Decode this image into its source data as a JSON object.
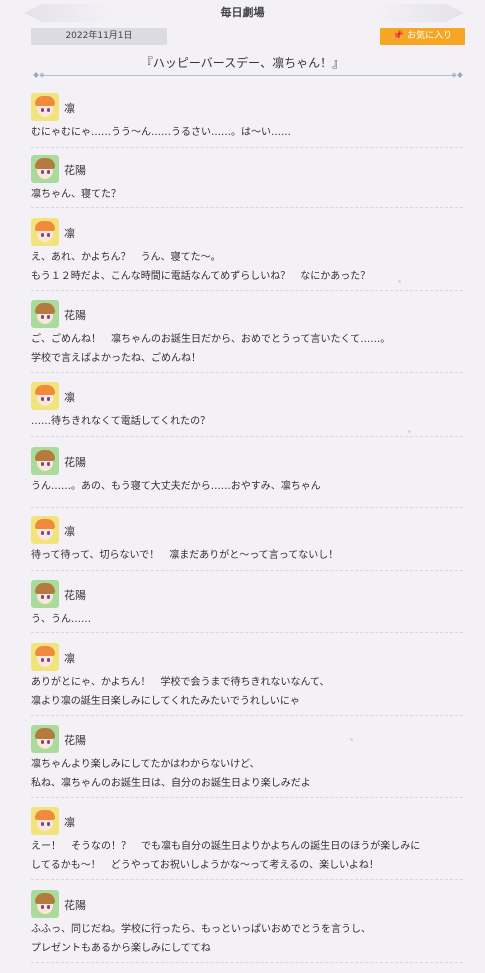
{
  "header": {
    "title": "毎日劇場"
  },
  "date": "2022年11月1日",
  "favorite_button": {
    "label": "お気に入り",
    "icon": "pin-icon"
  },
  "episode_title": "『ハッピーバースデー、凛ちゃん！』",
  "colors": {
    "accent": "#f5a623",
    "rin_bg": "#f2e47c",
    "hanayo_bg": "#a9dc9c"
  },
  "dialogue": [
    {
      "speaker": "凛",
      "char": "rin",
      "lines": [
        "むにゃむにゃ……うう～ん……うるさい……。は～い……"
      ]
    },
    {
      "speaker": "花陽",
      "char": "hanayo",
      "lines": [
        "凛ちゃん、寝てた？"
      ]
    },
    {
      "speaker": "凛",
      "char": "rin",
      "lines": [
        "え、あれ、かよちん？　うん、寝てた～。",
        "もう１２時だよ、こんな時間に電話なんてめずらしいね？　なにかあった？"
      ]
    },
    {
      "speaker": "花陽",
      "char": "hanayo",
      "lines": [
        "ご、ごめんね！　凛ちゃんのお誕生日だから、おめでとうって言いたくて……。",
        "学校で言えばよかったね、ごめんね！"
      ]
    },
    {
      "speaker": "凛",
      "char": "rin",
      "lines": [
        "……待ちきれなくて電話してくれたの？"
      ]
    },
    {
      "speaker": "花陽",
      "char": "hanayo",
      "lines": [
        "うん……。あの、もう寝て大丈夫だから……おやすみ、凛ちゃん"
      ]
    },
    {
      "speaker": "凛",
      "char": "rin",
      "lines": [
        "待って待って、切らないで！　凛まだありがと～って言ってないし！"
      ]
    },
    {
      "speaker": "花陽",
      "char": "hanayo",
      "lines": [
        "う、うん……"
      ]
    },
    {
      "speaker": "凛",
      "char": "rin",
      "lines": [
        "ありがとにゃ、かよちん！　学校で会うまで待ちきれないなんて、",
        "凛より凛の誕生日楽しみにしてくれたみたいでうれしいにゃ"
      ]
    },
    {
      "speaker": "花陽",
      "char": "hanayo",
      "lines": [
        "凛ちゃんより楽しみにしてたかはわからないけど、",
        "私ね、凛ちゃんのお誕生日は、自分のお誕生日より楽しみだよ"
      ]
    },
    {
      "speaker": "凛",
      "char": "rin",
      "lines": [
        "えー！　そうなの！？　でも凛も自分の誕生日よりかよちんの誕生日のほうが楽しみに",
        "してるかも～！　どうやってお祝いしようかな～って考えるの、楽しいよね！"
      ]
    },
    {
      "speaker": "花陽",
      "char": "hanayo",
      "lines": [
        "ふふっ、同じだね。学校に行ったら、もっといっぱいおめでとうを言うし、",
        "プレゼントもあるから楽しみにしててね"
      ]
    }
  ]
}
